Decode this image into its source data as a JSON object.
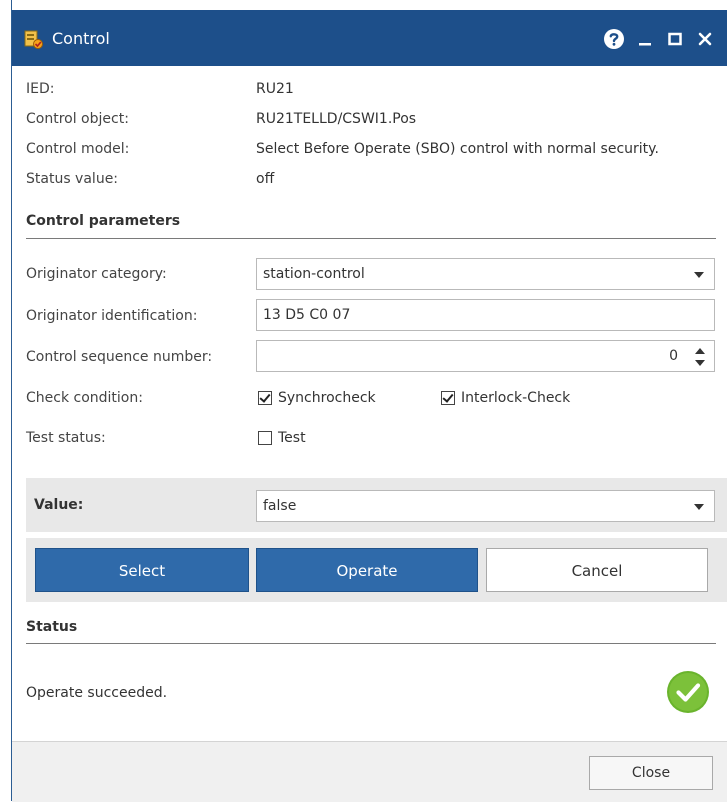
{
  "window": {
    "title": "Control",
    "icons": [
      "control-app-icon",
      "help-icon",
      "minimize-icon",
      "maximize-icon",
      "close-icon"
    ]
  },
  "info": {
    "ied_label": "IED:",
    "ied_value": "RU21",
    "control_object_label": "Control object:",
    "control_object_value": "RU21TELLD/CSWI1.Pos",
    "control_model_label": "Control model:",
    "control_model_value": "Select Before Operate (SBO) control with normal security.",
    "status_value_label": "Status value:",
    "status_value_value": "off"
  },
  "control_parameters": {
    "section_title": "Control parameters",
    "originator_category_label": "Originator category:",
    "originator_category_value": "station-control",
    "originator_identification_label": "Originator identification:",
    "originator_identification_value": "13 D5 C0 07",
    "control_sequence_number_label": "Control sequence number:",
    "control_sequence_number_value": "0",
    "check_condition_label": "Check condition:",
    "synchrocheck_label": "Synchrocheck",
    "synchrocheck_checked": true,
    "interlock_check_label": "Interlock-Check",
    "interlock_check_checked": true,
    "test_status_label": "Test status:",
    "test_label": "Test",
    "test_checked": false
  },
  "value": {
    "label": "Value:",
    "selected": "false"
  },
  "buttons": {
    "select": "Select",
    "operate": "Operate",
    "cancel": "Cancel",
    "close": "Close"
  },
  "status": {
    "section_title": "Status",
    "message": "Operate succeeded.",
    "icon": "success-check-icon"
  },
  "colors": {
    "titlebar": "#1d4f8a",
    "primary_button": "#2f6aaa",
    "success": "#6ab42d"
  }
}
